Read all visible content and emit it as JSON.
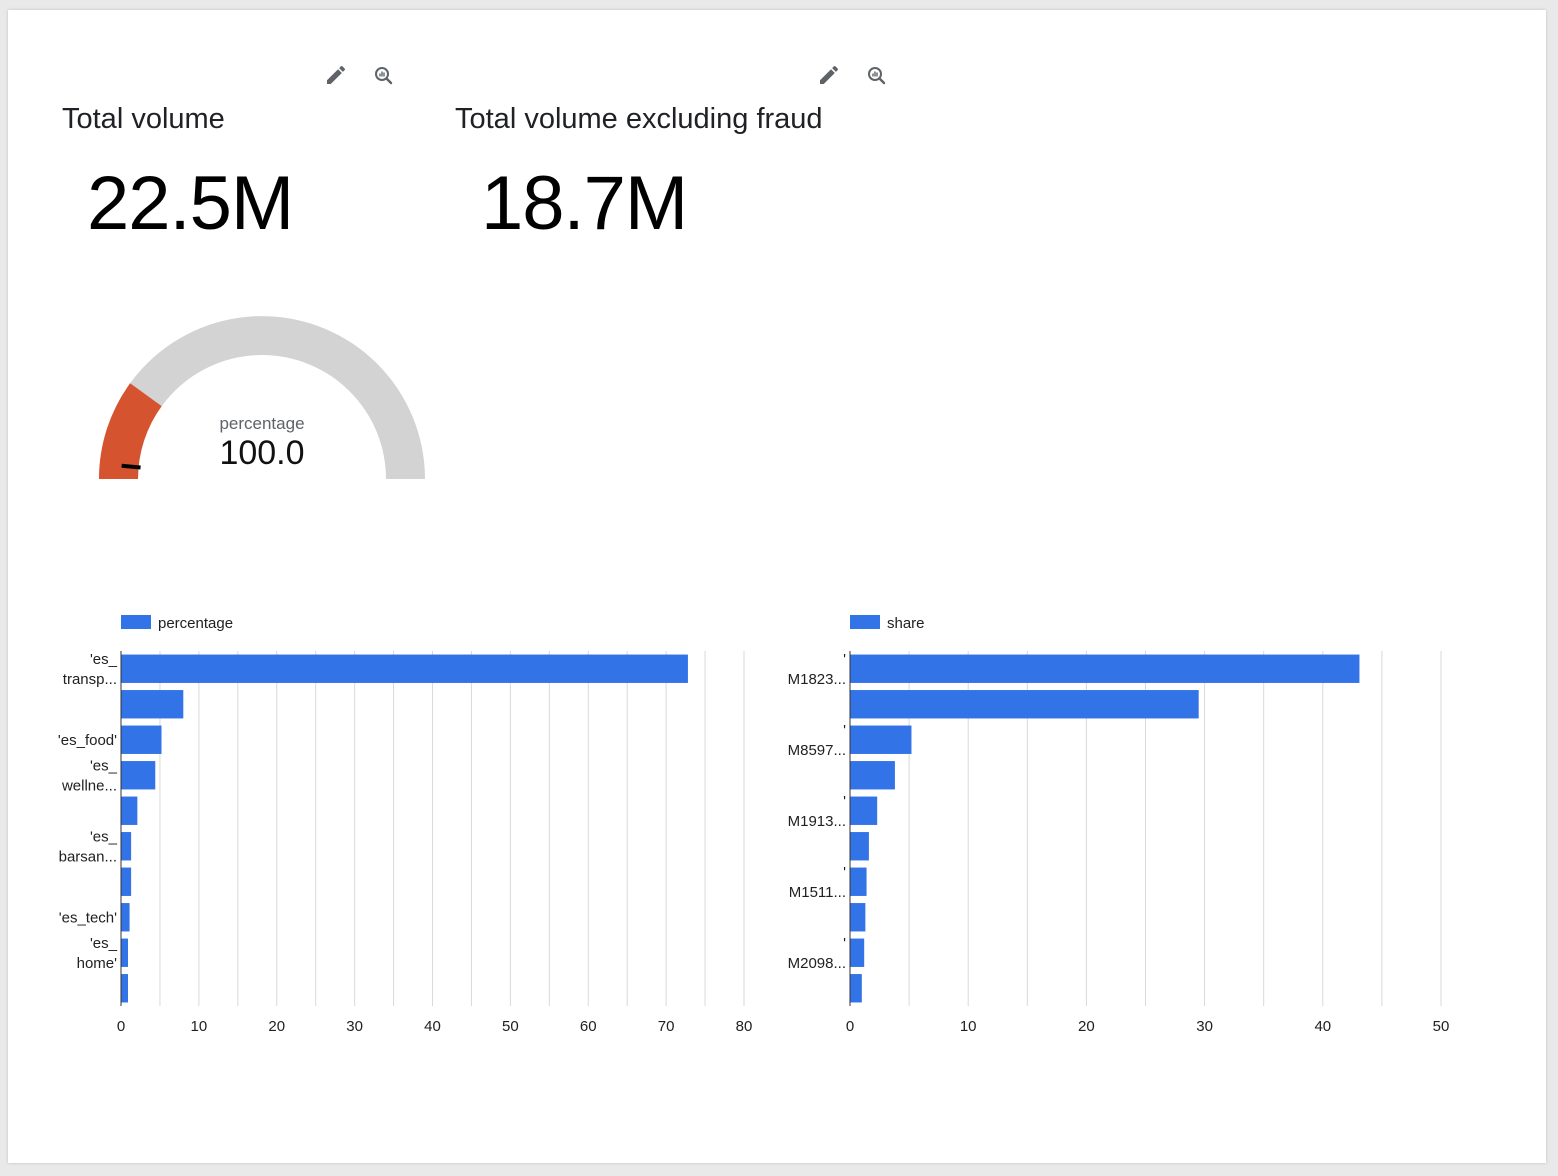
{
  "toolbar": {
    "edit_icon": "pencil-icon",
    "explore_icon": "explore-zoom-icon"
  },
  "scorecards": [
    {
      "title": "Total volume",
      "value": "22.5M"
    },
    {
      "title": "Total volume excluding fraud",
      "value": "18.7M"
    }
  ],
  "gauge": {
    "label": "percentage",
    "value": "100.0",
    "fill_fraction": 0.2,
    "needle_fraction": 0.03,
    "colors": {
      "fill": "#d65330",
      "track": "#d3d3d3",
      "needle": "#000000"
    }
  },
  "chart_data": [
    {
      "type": "bar",
      "orientation": "horizontal",
      "legend": "percentage",
      "legend_position": "top-left",
      "series_color": "#3273e8",
      "category_labels": [
        {
          "index": 0,
          "lines": [
            "'es_",
            "transp..."
          ]
        },
        {
          "index": 2,
          "lines": [
            "'es_food'"
          ]
        },
        {
          "index": 3,
          "lines": [
            "'es_",
            "wellne..."
          ]
        },
        {
          "index": 5,
          "lines": [
            "'es_",
            "barsan..."
          ]
        },
        {
          "index": 7,
          "lines": [
            "'es_tech'"
          ]
        },
        {
          "index": 8,
          "lines": [
            "'es_",
            "home'"
          ]
        }
      ],
      "values": [
        72.8,
        8.0,
        5.2,
        4.4,
        2.1,
        1.3,
        1.3,
        1.1,
        0.9,
        0.9
      ],
      "xlim": [
        0,
        80
      ],
      "xticks": [
        0,
        10,
        20,
        30,
        40,
        50,
        60,
        70,
        80
      ],
      "grid": true
    },
    {
      "type": "bar",
      "orientation": "horizontal",
      "legend": "share",
      "legend_position": "top-left",
      "series_color": "#3273e8",
      "category_labels": [
        {
          "index": 0,
          "lines": [
            "'",
            "M1823..."
          ]
        },
        {
          "index": 2,
          "lines": [
            "'",
            "M8597..."
          ]
        },
        {
          "index": 4,
          "lines": [
            "'",
            "M1913..."
          ]
        },
        {
          "index": 6,
          "lines": [
            "'",
            "M1511..."
          ]
        },
        {
          "index": 8,
          "lines": [
            "'",
            "M2098..."
          ]
        }
      ],
      "values": [
        43.1,
        29.5,
        5.2,
        3.8,
        2.3,
        1.6,
        1.4,
        1.3,
        1.2,
        1.0
      ],
      "xlim": [
        0,
        50
      ],
      "xticks": [
        0,
        10,
        20,
        30,
        40,
        50
      ],
      "grid": true
    }
  ]
}
